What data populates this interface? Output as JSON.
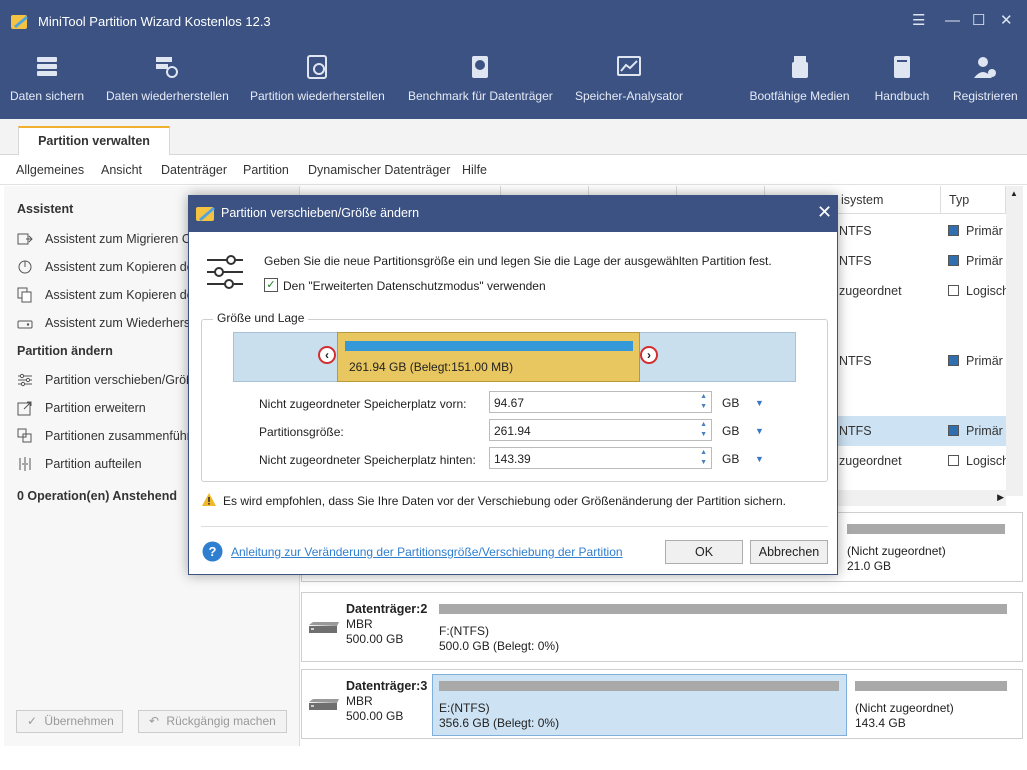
{
  "window": {
    "title": "MiniTool Partition Wizard Kostenlos 12.3"
  },
  "toolbar": [
    {
      "label": "Daten sichern",
      "icon": "backup-icon"
    },
    {
      "label": "Daten wiederherstellen",
      "icon": "data-recovery-icon"
    },
    {
      "label": "Partition wiederherstellen",
      "icon": "partition-recovery-icon"
    },
    {
      "label": "Benchmark für Datenträger",
      "icon": "benchmark-icon"
    },
    {
      "label": "Speicher-Analysator",
      "icon": "space-analyzer-icon"
    },
    {
      "label": "Bootfähige Medien",
      "icon": "bootable-media-icon"
    },
    {
      "label": "Handbuch",
      "icon": "manual-icon"
    },
    {
      "label": "Registrieren",
      "icon": "register-icon"
    }
  ],
  "tab": {
    "label": "Partition verwalten"
  },
  "menu": [
    "Allgemeines",
    "Ansicht",
    "Datenträger",
    "Partition",
    "Dynamischer Datenträger",
    "Hilfe"
  ],
  "sidebar": {
    "assistant_header": "Assistent",
    "assistant_items": [
      "Assistent zum Migrieren OS auf SSD/HDD",
      "Assistent zum Kopieren der Partition",
      "Assistent zum Kopieren des Datenträgers",
      "Assistent zum Wiederherstellen der Partition"
    ],
    "change_header": "Partition ändern",
    "change_items": [
      "Partition verschieben/Größe ändern",
      "Partition erweitern",
      "Partitionen zusammenführen",
      "Partition aufteilen"
    ],
    "pending": "0 Operation(en) Anstehend",
    "apply_label": "Übernehmen",
    "undo_label": "Rückgängig machen"
  },
  "table": {
    "col_fs": "isystem",
    "col_type": "Typ",
    "rows": [
      {
        "fs": "NTFS",
        "type": "Primär"
      },
      {
        "fs": "NTFS",
        "type": "Primär"
      },
      {
        "fs": "zugeordnet",
        "type": "Logisch"
      },
      {
        "fs": "NTFS",
        "type": "Primär"
      },
      {
        "fs": "NTFS",
        "type": "Primär"
      },
      {
        "fs": "zugeordnet",
        "type": "Logisch"
      }
    ]
  },
  "disks": {
    "disk1_unalloc": {
      "label": "(Nicht zugeordnet)",
      "size": "21.0 GB"
    },
    "disk2": {
      "name": "Datenträger:2",
      "type": "MBR",
      "size": "500.00 GB",
      "part_label": "F:(NTFS)",
      "part_size": "500.0 GB (Belegt: 0%)"
    },
    "disk3": {
      "name": "Datenträger:3",
      "type": "MBR",
      "size": "500.00 GB",
      "part_label": "E:(NTFS)",
      "part_size": "356.6 GB (Belegt: 0%)",
      "unalloc_label": "(Nicht zugeordnet)",
      "unalloc_size": "143.4 GB"
    }
  },
  "dialog": {
    "title": "Partition verschieben/Größe ändern",
    "description": "Geben Sie die neue Partitionsgröße ein und legen Sie die Lage der ausgewählten Partition fest.",
    "checkbox_label": "Den \"Erweiterten Datenschutzmodus\" verwenden",
    "group_title": "Größe und Lage",
    "partition_block_label": "261.94 GB (Belegt:151.00 MB)",
    "fields": [
      {
        "label": "Nicht zugeordneter Speicherplatz vorn:",
        "value": "94.67",
        "unit": "GB"
      },
      {
        "label": "Partitionsgröße:",
        "value": "261.94",
        "unit": "GB"
      },
      {
        "label": "Nicht zugeordneter Speicherplatz hinten:",
        "value": "143.39",
        "unit": "GB"
      }
    ],
    "warning": "Es wird empfohlen, dass Sie Ihre Daten vor der Verschiebung oder Größenänderung der Partition sichern.",
    "help_link": "Anleitung zur Veränderung der Partitionsgröße/Verschiebung der Partition",
    "ok_label": "OK",
    "cancel_label": "Abbrechen"
  },
  "colors": {
    "titlebar": "#3b5283",
    "partition_block": "#e8c760",
    "used_bar": "#3498d9",
    "track": "#c9dfee",
    "handle_ring": "#d32f2f"
  }
}
